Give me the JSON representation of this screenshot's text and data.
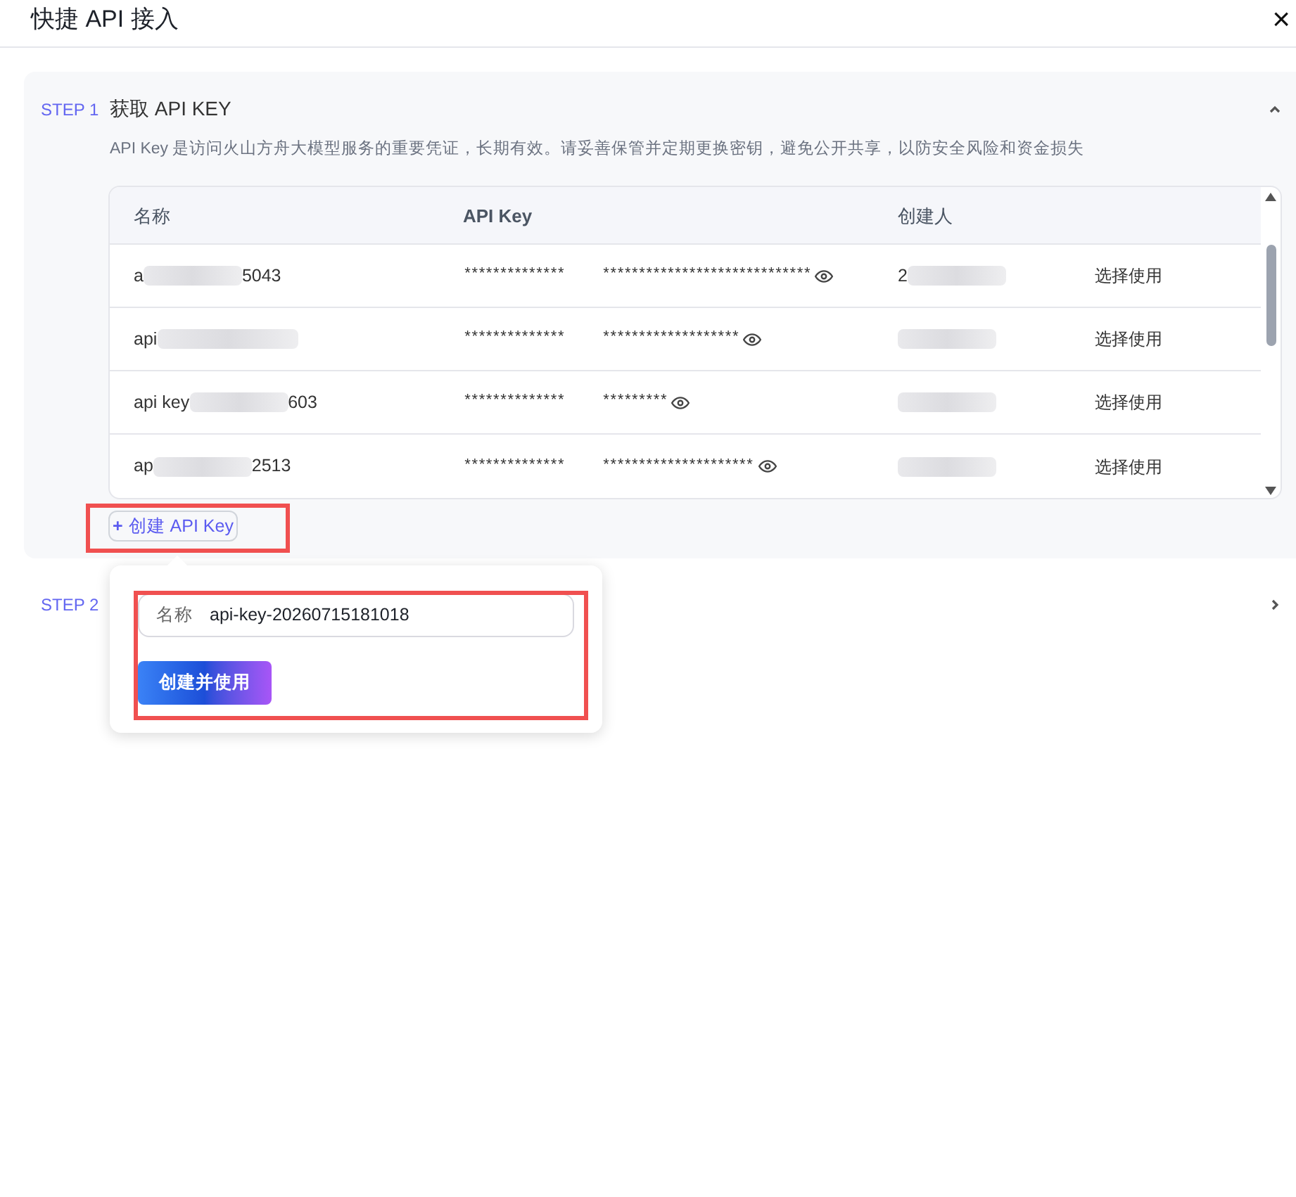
{
  "dialog": {
    "title": "快捷 API 接入",
    "close": "×"
  },
  "steps": [
    {
      "step": "STEP 1",
      "title": "获取 API KEY",
      "expanded": true,
      "description": "API Key 是访问火山方舟大模型服务的重要凭证，长期有效。请妥善保管并定期更换密钥，避免公开共享，以防安全风险和资金损失"
    },
    {
      "step": "STEP 2",
      "expanded": false
    }
  ],
  "table": {
    "columns": [
      "名称",
      "API Key",
      "创建人"
    ],
    "rows": [
      {
        "name_start": "a",
        "name_end": "5043",
        "key": "************** *****************************",
        "creator": "2",
        "action": "选择使用"
      },
      {
        "name_start": "api",
        "name_end": "",
        "key": "************** *******************",
        "creator": "",
        "action": "选择使用"
      },
      {
        "name_start": "api key",
        "name_end": "603",
        "key": "************** *********",
        "creator": "",
        "action": "选择使用"
      },
      {
        "name_start": "ap",
        "name_end": "2513",
        "key": "************** *********************",
        "creator": "",
        "action": "选择使用"
      }
    ]
  },
  "create_button": {
    "icon": "+",
    "label": "创建 API Key"
  },
  "popover": {
    "field_label": "名称",
    "field_value": "api-key-20260715181018",
    "submit": "创建并使用"
  },
  "annotations": [
    {
      "kind": "highlight"
    },
    {
      "kind": "highlight"
    }
  ]
}
